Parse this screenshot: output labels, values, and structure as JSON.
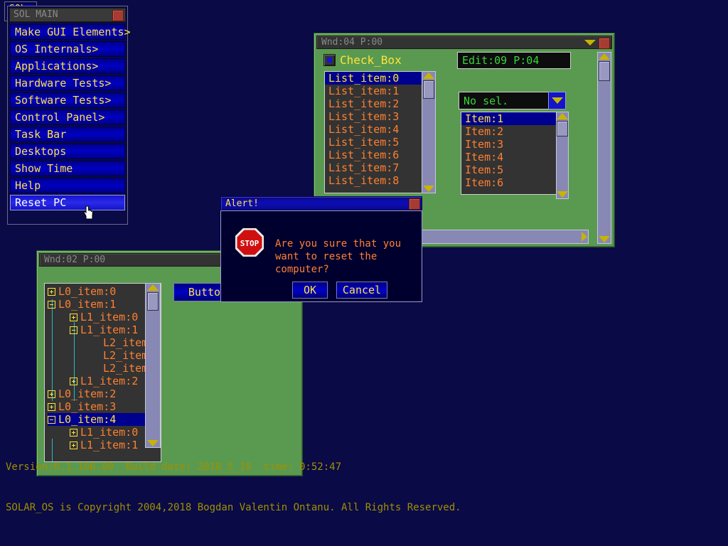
{
  "desktop": {
    "bg_color": "#0a0a46",
    "version_line1": "Version:0.1.106.00  Build date: 2018_5_10  time: 0:52:47",
    "version_line2": "SOLAR_OS is Copyright 2004,2018 Bogdan Valentin Ontanu. All Rights Reserved."
  },
  "behind_window": {
    "title": "SOL"
  },
  "main_menu": {
    "title": "SOL MAIN",
    "close_icon": "close-box",
    "items": [
      {
        "label": "Make GUI Elements>",
        "highlighted": false
      },
      {
        "label": "OS Internals>",
        "highlighted": false
      },
      {
        "label": "Applications>",
        "highlighted": false
      },
      {
        "label": "Hardware Tests>",
        "highlighted": false
      },
      {
        "label": "Software Tests>",
        "highlighted": false
      },
      {
        "label": "Control Panel>",
        "highlighted": false
      },
      {
        "label": "Task Bar",
        "highlighted": false
      },
      {
        "label": "Desktops",
        "highlighted": false
      },
      {
        "label": "Show Time",
        "highlighted": false
      },
      {
        "label": "Help",
        "highlighted": false
      },
      {
        "label": "Reset PC",
        "highlighted": true
      }
    ]
  },
  "window_04": {
    "title": "Wnd:04 P:00",
    "checkbox": {
      "label": "Check_Box",
      "checked": true
    },
    "edit": {
      "value": "Edit:09 P:04"
    },
    "listbox": {
      "items": [
        "List_item:0",
        "List_item:1",
        "List_item:2",
        "List_item:3",
        "List_item:4",
        "List_item:5",
        "List_item:6",
        "List_item:7",
        "List_item:8"
      ],
      "selected_index": 0
    },
    "combo": {
      "value": "No sel.",
      "options": [
        "Item:1",
        "Item:2",
        "Item:3",
        "Item:4",
        "Item:5",
        "Item:6"
      ],
      "selected_index": 0
    }
  },
  "window_02": {
    "title": "Wnd:02 P:00",
    "button_label": "Button",
    "tree": {
      "nodes": [
        {
          "label": "L0_item:0",
          "depth": 0,
          "state": "plus",
          "selected": false
        },
        {
          "label": "L0_item:1",
          "depth": 0,
          "state": "minus",
          "selected": false
        },
        {
          "label": "L1_item:0",
          "depth": 1,
          "state": "plus",
          "selected": false
        },
        {
          "label": "L1_item:1",
          "depth": 1,
          "state": "minus",
          "selected": false
        },
        {
          "label": "L2_item",
          "depth": 2,
          "state": "none",
          "selected": false
        },
        {
          "label": "L2_item",
          "depth": 2,
          "state": "none",
          "selected": false
        },
        {
          "label": "L2_item",
          "depth": 2,
          "state": "none",
          "selected": false
        },
        {
          "label": "L1_item:2",
          "depth": 1,
          "state": "plus",
          "selected": false
        },
        {
          "label": "L0_item:2",
          "depth": 0,
          "state": "plus",
          "selected": false
        },
        {
          "label": "L0_item:3",
          "depth": 0,
          "state": "plus",
          "selected": false
        },
        {
          "label": "L0_item:4",
          "depth": 0,
          "state": "minus",
          "selected": true
        },
        {
          "label": "L1_item:0",
          "depth": 1,
          "state": "plus",
          "selected": false
        },
        {
          "label": "L1_item:1",
          "depth": 1,
          "state": "plus",
          "selected": false
        }
      ]
    }
  },
  "alert": {
    "title": "Alert!",
    "icon": "stop-icon",
    "icon_text": "STOP",
    "message": "Are you sure that you\nwant to reset the\ncomputer?",
    "ok_label": "OK",
    "cancel_label": "Cancel"
  },
  "colors": {
    "desktop": "#0a0a46",
    "window_green": "#5a9a50",
    "titlebar_gray": "#333333",
    "accent_yellow": "#ffe23c",
    "list_orange": "#ff8030",
    "select_blue": "#00008f",
    "edit_green": "#3cd23c",
    "scrollbar": "#8888b4",
    "arrow_yellow": "#c8b400",
    "stop_red": "#d01010"
  }
}
